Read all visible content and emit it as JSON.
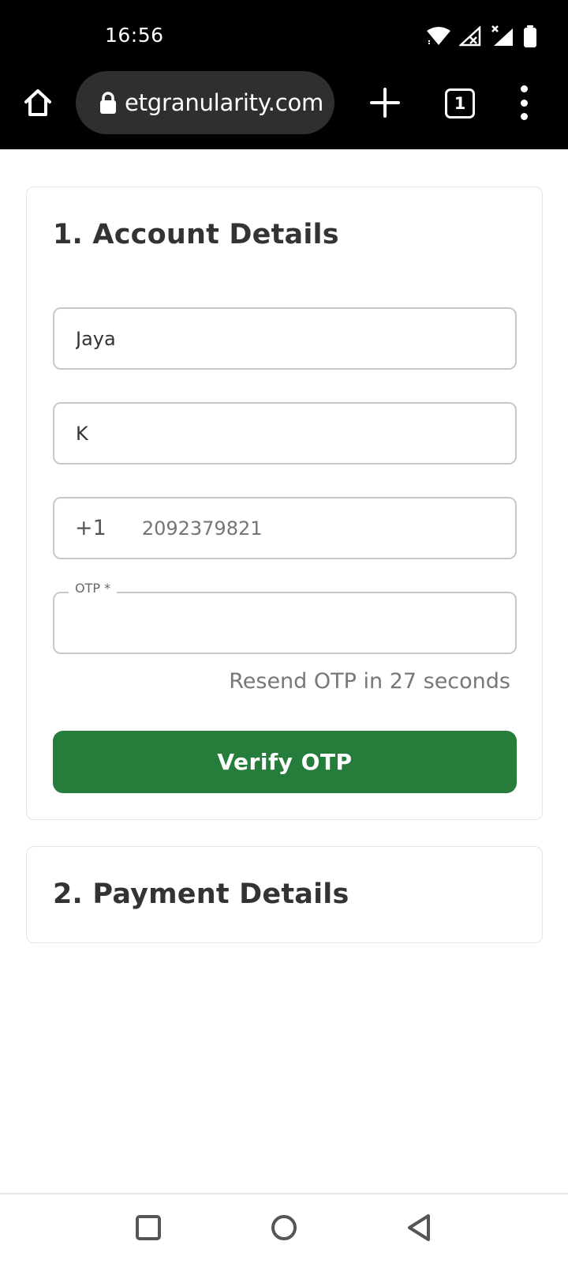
{
  "status_bar": {
    "time": "16:56",
    "icons": [
      "wifi-icon",
      "signal-no-service-icon",
      "signal-x-icon",
      "battery-icon"
    ]
  },
  "browser": {
    "url": "etgranularity.com",
    "tab_count": "1",
    "icons": [
      "home-icon",
      "lock-icon",
      "plus-icon",
      "tab-switcher-icon",
      "more-vert-icon"
    ]
  },
  "account": {
    "title": "1. Account Details",
    "first_name": "Jaya",
    "last_name": "K",
    "phone_code": "+1",
    "phone_placeholder": "2092379821",
    "otp_label": "OTP *",
    "otp_value": "",
    "resend_text": "Resend OTP in 27 seconds",
    "verify_label": "Verify OTP"
  },
  "payment": {
    "title": "2. Payment Details"
  },
  "colors": {
    "primary_button": "#267d3b",
    "status_bar": "#000000",
    "url_bar": "#2f2f2f"
  },
  "nav": {
    "icons": [
      "recents-square-icon",
      "home-circle-icon",
      "back-triangle-icon"
    ]
  }
}
